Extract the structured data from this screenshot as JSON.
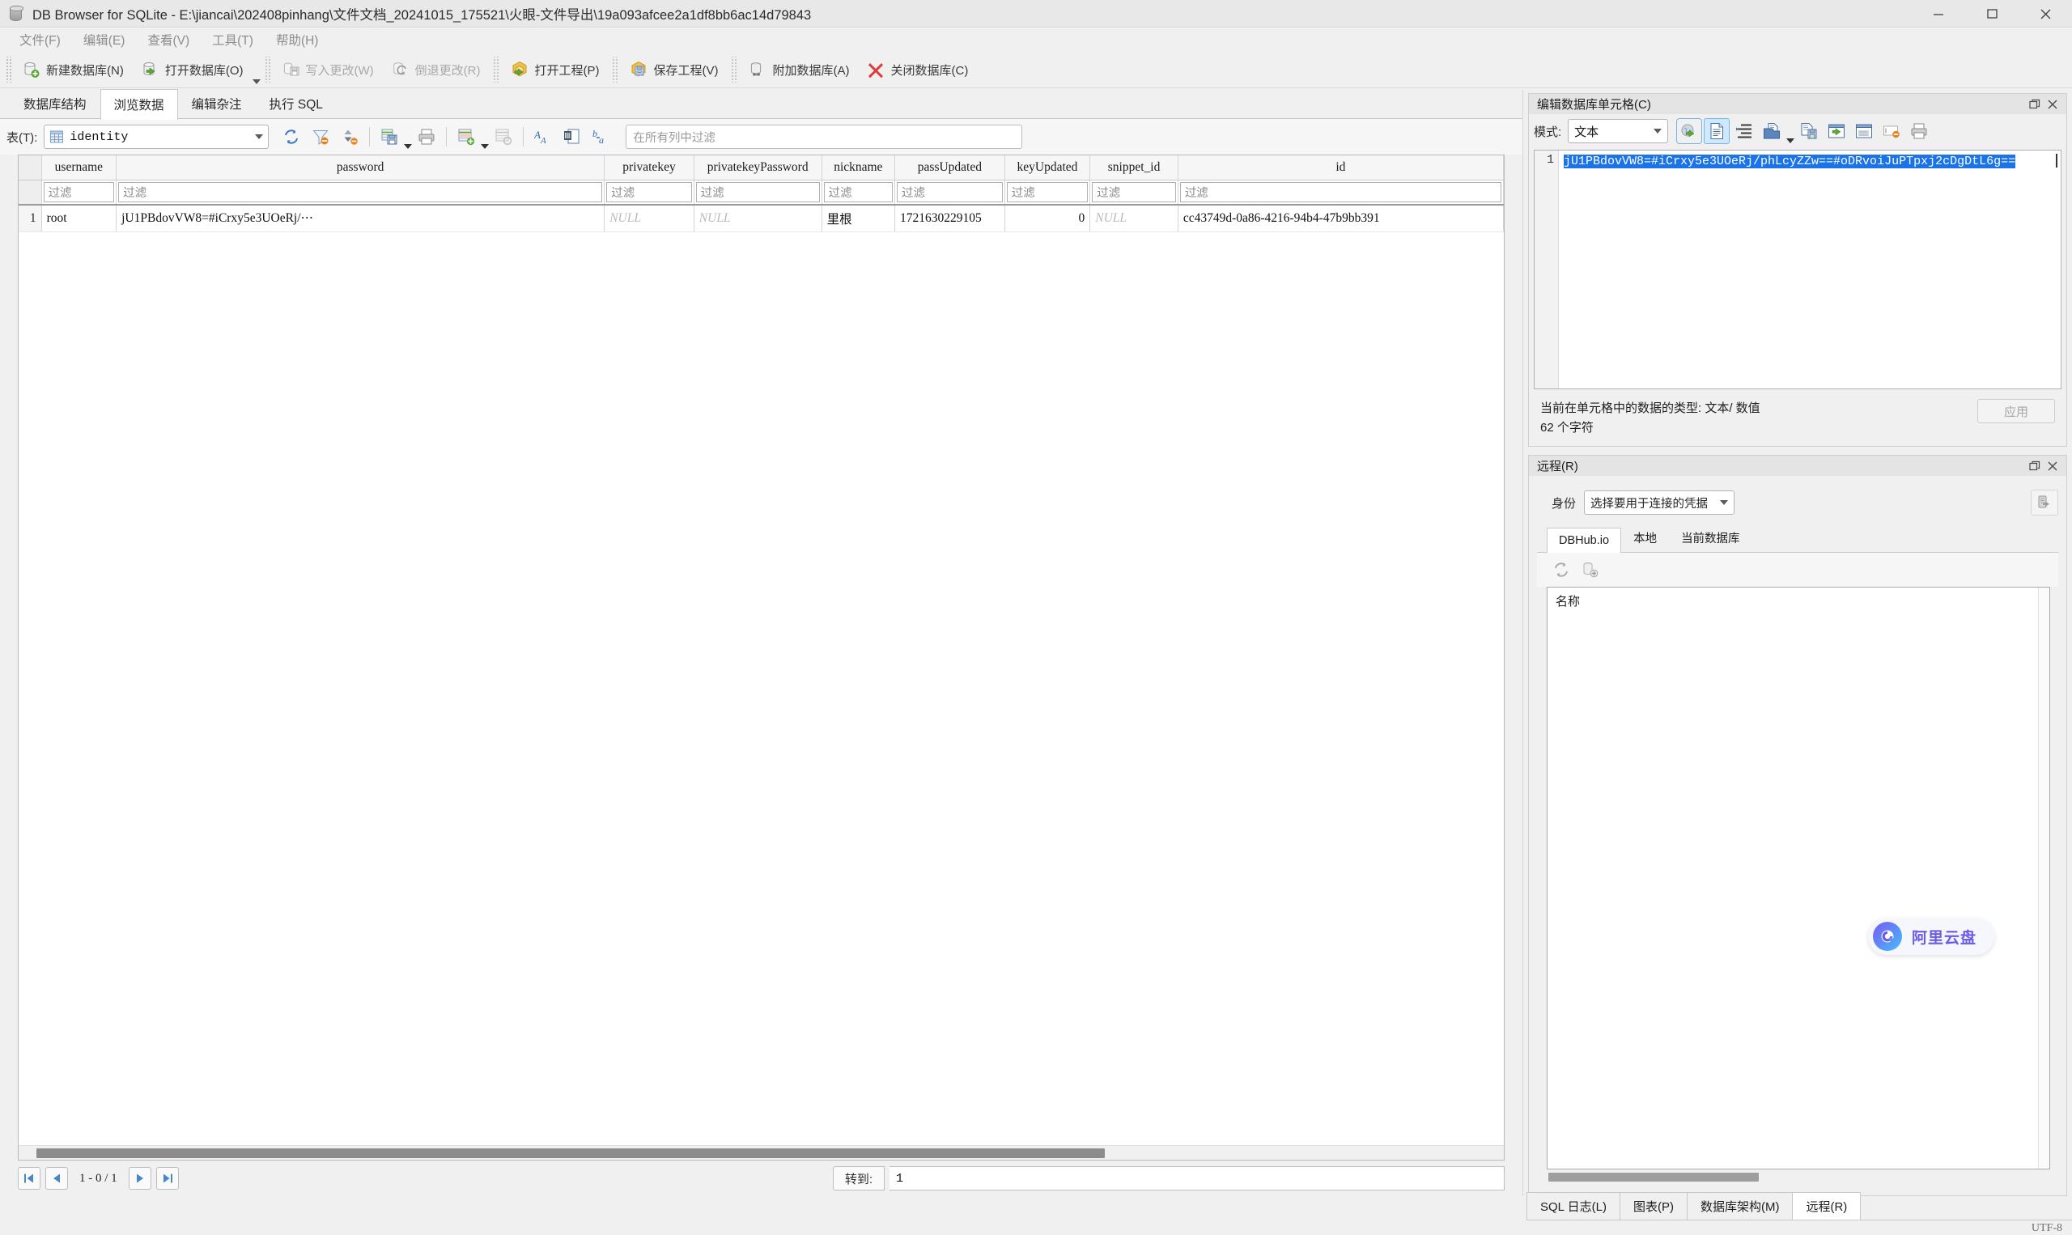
{
  "window": {
    "title": "DB Browser for SQLite - E:\\jiancai\\202408pinhang\\文件文档_20241015_175521\\火眼-文件导出\\19a093afcee2a1df8bb6ac14d79843",
    "minimize": "−",
    "maximize": "□",
    "close": "✕"
  },
  "menubar": {
    "items": [
      {
        "label": "文件(F)"
      },
      {
        "label": "编辑(E)"
      },
      {
        "label": "查看(V)"
      },
      {
        "label": "工具(T)"
      },
      {
        "label": "帮助(H)"
      }
    ]
  },
  "toolbar": {
    "items": [
      {
        "label": "新建数据库(N)",
        "icon": "new-database-icon",
        "disabled": false
      },
      {
        "label": "打开数据库(O)",
        "icon": "open-database-icon",
        "disabled": false
      },
      {
        "label": "写入更改(W)",
        "icon": "write-changes-icon",
        "disabled": true
      },
      {
        "label": "倒退更改(R)",
        "icon": "revert-changes-icon",
        "disabled": true
      },
      {
        "label": "打开工程(P)",
        "icon": "open-project-icon",
        "disabled": false
      },
      {
        "label": "保存工程(V)",
        "icon": "save-project-icon",
        "disabled": false
      },
      {
        "label": "附加数据库(A)",
        "icon": "attach-database-icon",
        "disabled": false
      },
      {
        "label": "关闭数据库(C)",
        "icon": "close-database-icon",
        "disabled": false
      }
    ]
  },
  "tabs": [
    {
      "label": "数据库结构",
      "active": false
    },
    {
      "label": "浏览数据",
      "active": true
    },
    {
      "label": "编辑杂注",
      "active": false
    },
    {
      "label": "执行 SQL",
      "active": false
    }
  ],
  "browse": {
    "table_label": "表(T):",
    "table_value": "identity",
    "filter_placeholder": "在所有列中过滤",
    "icons": [
      "refresh-icon",
      "clear-filters-icon",
      "clear-sorting-icon",
      "save-results-icon",
      "print-icon",
      "insert-record-icon",
      "delete-record-icon",
      "font-size-icon",
      "find-replace-icon",
      "conditional-format-icon"
    ]
  },
  "grid": {
    "filter_placeholder": "过滤",
    "columns": [
      "username",
      "password",
      "privatekey",
      "privatekeyPassword",
      "nickname",
      "passUpdated",
      "keyUpdated",
      "snippet_id",
      "id"
    ],
    "rows": [
      {
        "rownum": "1",
        "cells": [
          {
            "value": "root",
            "null": false,
            "numeric": false
          },
          {
            "value": "jU1PBdovVW8=#iCrxy5e3UOeRj/⋯",
            "null": false,
            "numeric": false
          },
          {
            "value": "NULL",
            "null": true,
            "numeric": false
          },
          {
            "value": "NULL",
            "null": true,
            "numeric": false
          },
          {
            "value": "里根",
            "null": false,
            "numeric": false
          },
          {
            "value": "1721630229105",
            "null": false,
            "numeric": false
          },
          {
            "value": "0",
            "null": false,
            "numeric": true
          },
          {
            "value": "NULL",
            "null": true,
            "numeric": false
          },
          {
            "value": "cc43749d-0a86-4216-94b4-47b9bb391",
            "null": false,
            "numeric": false
          }
        ]
      }
    ]
  },
  "pager": {
    "first": "first-page-icon",
    "prev": "previous-page-icon",
    "range": "1 - 0 / 1",
    "next": "next-page-icon",
    "last": "last-page-icon",
    "goto_label": "转到:",
    "goto_value": "1"
  },
  "cell_editor": {
    "title": "编辑数据库单元格(C)",
    "mode_label": "模式:",
    "mode_value": "文本",
    "line_number": "1",
    "content": "jU1PBdovVW8=#iCrxy5e3UOeRj/phLcyZZw==#oDRvoiJuPTpxj2cDgDtL6g==",
    "status_type": "当前在单元格中的数据的类型: 文本/ 数值",
    "status_count": "62 个字符",
    "apply_label": "应用",
    "toolbar_icons": [
      "import-data-icon",
      "text-mode-icon",
      "word-wrap-icon",
      "open-file-icon",
      "save-file-icon",
      "export-icon",
      "set-as-null-icon",
      "null-indicator-icon",
      "print-cell-icon"
    ]
  },
  "remote": {
    "title": "远程(R)",
    "identity_label": "身份",
    "identity_value": "选择要用于连接的凭据",
    "tabs": [
      {
        "label": "DBHub.io",
        "active": true
      },
      {
        "label": "本地",
        "active": false
      },
      {
        "label": "当前数据库",
        "active": false
      }
    ],
    "toolbar_icons": [
      "refresh-remote-icon",
      "clone-database-icon"
    ],
    "list_header": "名称"
  },
  "bottom_tabs": [
    {
      "label": "SQL 日志(L)",
      "active": false
    },
    {
      "label": "图表(P)",
      "active": false
    },
    {
      "label": "数据库架构(M)",
      "active": false
    },
    {
      "label": "远程(R)",
      "active": true
    }
  ],
  "statusbar": {
    "encoding": "UTF-8"
  },
  "watermark": {
    "label": "阿里云盘"
  },
  "colors": {
    "selection": "#1a73e8",
    "accent": "#cde8ff",
    "window_bg": "#f0f0f0"
  }
}
